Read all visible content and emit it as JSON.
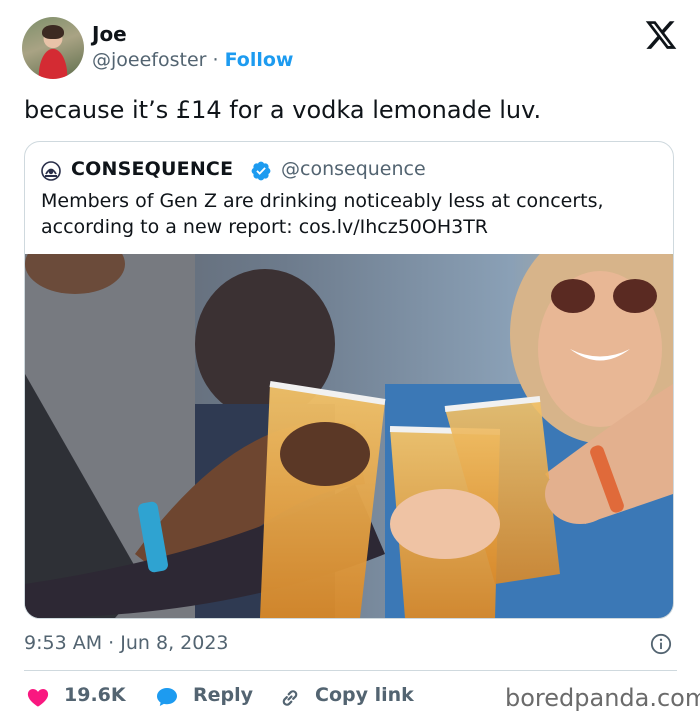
{
  "author": {
    "name": "Joe",
    "handle": "@joeefoster",
    "separator": "·",
    "follow_label": "Follow"
  },
  "tweet": {
    "text": "because it’s £14 for a vodka lemonade luv."
  },
  "quoted": {
    "name": "CONSEQUENCE",
    "handle": "@consequence",
    "text_lines": [
      "Members of Gen Z are drinking noticeably less at concerts,",
      "according to a new report: cos.lv/Ihcz50OH3TR"
    ]
  },
  "meta": {
    "time": "9:53 AM",
    "separator": "·",
    "date": "Jun 8, 2023"
  },
  "actions": {
    "likes": "19.6K",
    "reply_label": "Reply",
    "copy_label": "Copy link"
  },
  "watermark": "boredpanda.com",
  "icons": {
    "brand": "x-logo-icon",
    "verified": "verified-badge-icon",
    "info": "info-icon",
    "like": "heart-icon",
    "reply": "speech-bubble-icon",
    "copy": "link-icon"
  },
  "colors": {
    "accent": "#1d9bf0",
    "like": "#f91880",
    "text": "#0f1419",
    "muted": "#536471",
    "border": "#cfd9de"
  }
}
